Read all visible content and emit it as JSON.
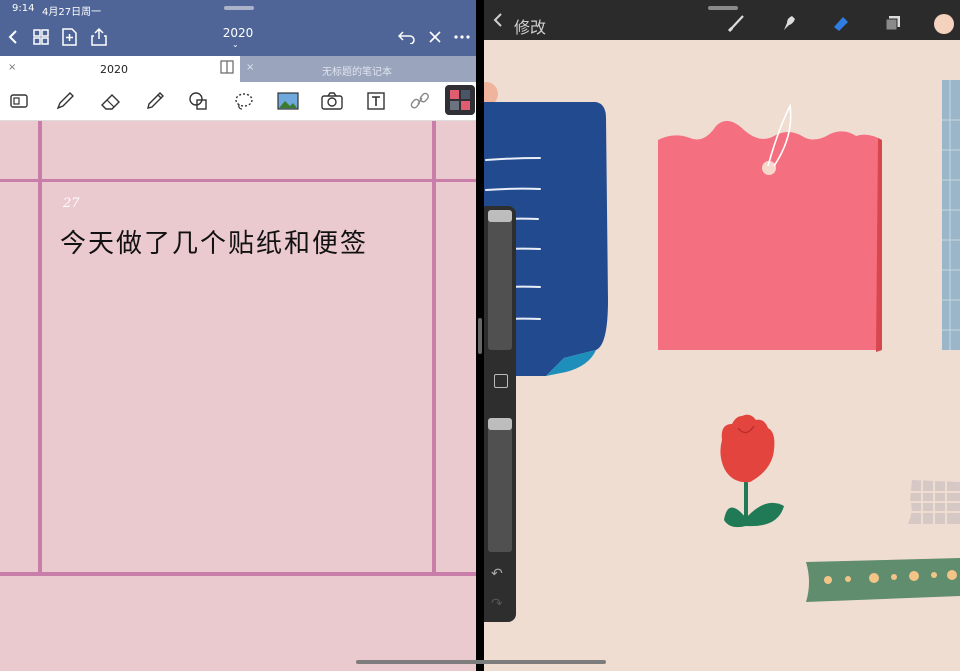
{
  "status": {
    "time": "9:14",
    "date": "4月27日周一"
  },
  "notes_app": {
    "title": "2020",
    "tabs": [
      {
        "label": "2020",
        "active": true
      },
      {
        "label": "无标题的笔记本",
        "active": false
      }
    ],
    "toolbar_tools": [
      "page-view-icon",
      "pen-icon",
      "eraser-icon",
      "highlighter-icon",
      "shapes-icon",
      "lasso-icon",
      "image-icon",
      "camera-icon",
      "text-box-icon",
      "link-icon",
      "sticker-icon"
    ],
    "note": {
      "date": "27",
      "text": "今天做了几个贴纸和便签"
    },
    "colors": {
      "header": "#4f6597",
      "paper": "#eac9cf",
      "grid_line": "#c97eaa"
    }
  },
  "drawing_app": {
    "back_label": "修改",
    "tools": [
      "brush-icon",
      "smudge-icon",
      "eraser-icon",
      "layers-icon",
      "color-swatch"
    ],
    "active_tool": "eraser-icon",
    "current_color": "#f4d2bd",
    "canvas_background": "#f0ddd1"
  }
}
